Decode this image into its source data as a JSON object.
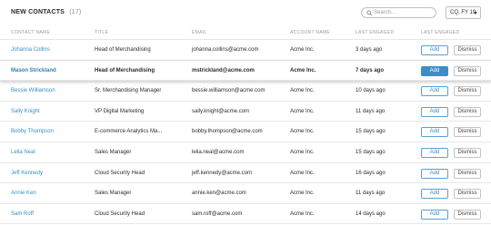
{
  "header": {
    "title": "NEW CONTACTS",
    "count": "(17)",
    "search_placeholder": "Search...",
    "period_label": "CQ, FY 19"
  },
  "columns": [
    "CONTACT NAME",
    "TITLE",
    "EMAIL",
    "ACCOUNT NAME",
    "LAST ENGAGED",
    "LAST ENGAGED"
  ],
  "buttons": {
    "add": "Add",
    "dismiss": "Dismiss"
  },
  "rows": [
    {
      "name": "Johanna Collins",
      "title": "Head of Merchandising",
      "email": "johanna.collins@acme.com",
      "account": "Acme Inc.",
      "engaged": "3 days ago"
    },
    {
      "name": "Mason Strickland",
      "title": "Head of Merchandising",
      "email": "mstrickland@acme.com",
      "account": "Acme Inc.",
      "engaged": "7 days ago",
      "selected": true
    },
    {
      "name": "Bessie Williamson",
      "title": "Sr. Merchandising Manager",
      "email": "bessie.williamson@acme.com",
      "account": "Acme Inc.",
      "engaged": "10 days ago"
    },
    {
      "name": "Sally Knight",
      "title": "VP Digital Marketing",
      "email": "sally.knight@acme.com",
      "account": "Acme Inc.",
      "engaged": "11 days ago"
    },
    {
      "name": "Bobby Thompson",
      "title": "E-commerce Analytics Ma...",
      "email": "bobby.thompson@acme.com",
      "account": "Acme Inc.",
      "engaged": "15 days ago"
    },
    {
      "name": "Lelia Neal",
      "title": "Sales Manager",
      "email": "lelia.neal@acme.com",
      "account": "Acme Inc.",
      "engaged": "15 days ago"
    },
    {
      "name": "Jeff Kennedy",
      "title": "Cloud Security Head",
      "email": "jeff.kennedy@acme.com",
      "account": "Acme Inc.",
      "engaged": "16 days ago"
    },
    {
      "name": "Annie Ken",
      "title": "Sales Manager",
      "email": "annie.ken@acme.com",
      "account": "Acme Inc.",
      "engaged": "11 days ago"
    },
    {
      "name": "Sam Roff",
      "title": "Cloud Security Head",
      "email": "sam.roff@acme.com",
      "account": "Acme Inc.",
      "engaged": "14 days ago"
    }
  ],
  "colors": {
    "accent": "#3a8fc4",
    "border": "#e8e8e8",
    "muted": "#9a9a9a"
  },
  "icons": {
    "search": "search-icon",
    "caret": "chevron-down-icon"
  }
}
